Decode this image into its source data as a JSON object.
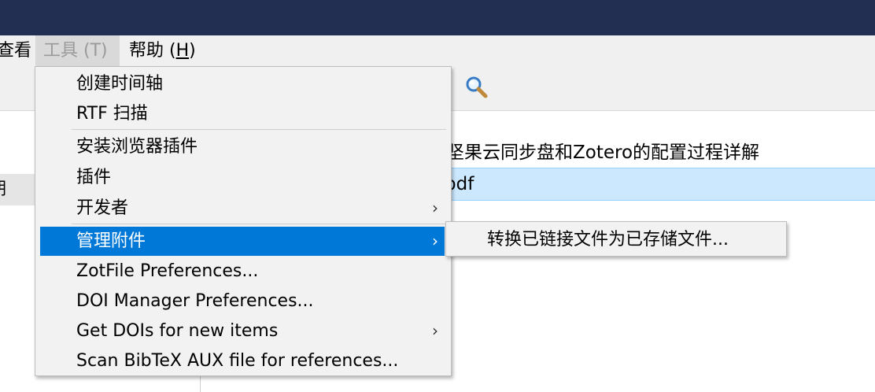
{
  "menubar": {
    "view_partial": "查看",
    "tools": "工具 (T)",
    "help_text": "帮助 (",
    "help_key": "H",
    "help_close": ")"
  },
  "toolbar": {
    "search_icon": "magnifier-icon"
  },
  "left_pane": {
    "selected_partial": "期"
  },
  "item": {
    "title": "坚果云同步盘和Zotero的配置过程详解",
    "attachment_partial": "pdf"
  },
  "tools_menu": {
    "create_timeline": "创建时间轴",
    "rtf_scan": "RTF 扫描",
    "install_browser_plugin": "安装浏览器插件",
    "plugins": "插件",
    "developer": "开发者",
    "manage_attachments": "管理附件",
    "zotfile_prefs": "ZotFile Preferences...",
    "doi_manager_prefs": "DOI Manager Preferences...",
    "get_dois": "Get DOIs for new items",
    "scan_bibtex": "Scan BibTeX AUX file for references...",
    "submenu_arrow": "›"
  },
  "attachments_submenu": {
    "convert_linked": "转换已链接文件为已存储文件..."
  },
  "colors": {
    "titlebar": "#232f52",
    "highlight": "#0078d7",
    "selection_row": "#cce8ff"
  }
}
